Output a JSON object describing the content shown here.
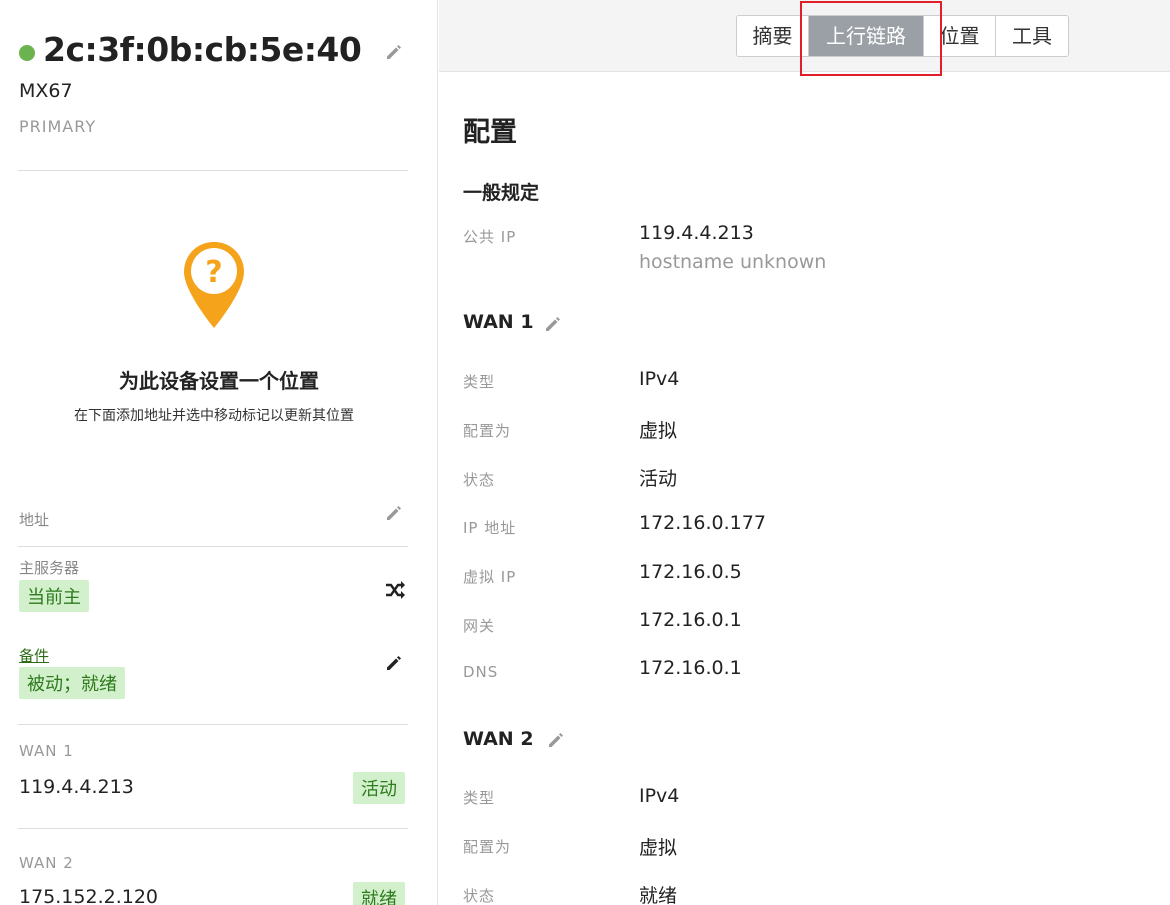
{
  "device": {
    "name": "2c:3f:0b:cb:5e:40",
    "model": "MX67",
    "role": "PRIMARY",
    "status_color": "#6bb34f"
  },
  "location": {
    "heading": "为此设备设置一个位置",
    "subtext": "在下面添加地址并选中移动标记以更新其位置",
    "pin_glyph": "?",
    "pin_color": "#f5a31a"
  },
  "sidebar": {
    "address_label": "地址",
    "main_server_label": "主服务器",
    "main_server_badge": "当前主",
    "spare_label": "备件",
    "spare_badge": "被动；就绪",
    "wan1_label": "WAN 1",
    "wan1_ip": "119.4.4.213",
    "wan1_badge": "活动",
    "wan2_label": "WAN 2",
    "wan2_ip": "175.152.2.120",
    "wan2_badge": "就绪"
  },
  "tabs": [
    {
      "label": "摘要",
      "active": false
    },
    {
      "label": "上行链路",
      "active": true
    },
    {
      "label": "位置",
      "active": false
    },
    {
      "label": "工具",
      "active": false
    }
  ],
  "config": {
    "title": "配置",
    "general": {
      "heading": "一般规定",
      "public_ip_label": "公共 IP",
      "public_ip": "119.4.4.213",
      "hostname": "hostname unknown"
    },
    "wan1": {
      "heading": "WAN 1",
      "type_label": "类型",
      "type": "IPv4",
      "configured_as_label": "配置为",
      "configured_as": "虚拟",
      "status_label": "状态",
      "status": "活动",
      "ip_label": "IP 地址",
      "ip": "172.16.0.177",
      "vip_label": "虚拟 IP",
      "vip": "172.16.0.5",
      "gateway_label": "网关",
      "gateway": "172.16.0.1",
      "dns_label": "DNS",
      "dns": "172.16.0.1"
    },
    "wan2": {
      "heading": "WAN 2",
      "type_label": "类型",
      "type": "IPv4",
      "configured_as_label": "配置为",
      "configured_as": "虚拟",
      "status_label": "状态",
      "status": "就绪"
    }
  },
  "colors": {
    "badge_bg": "#d2f0cc",
    "badge_text": "#2e7a1d",
    "active_tab": "#9aa0a6",
    "highlight": "#e01f2b"
  }
}
